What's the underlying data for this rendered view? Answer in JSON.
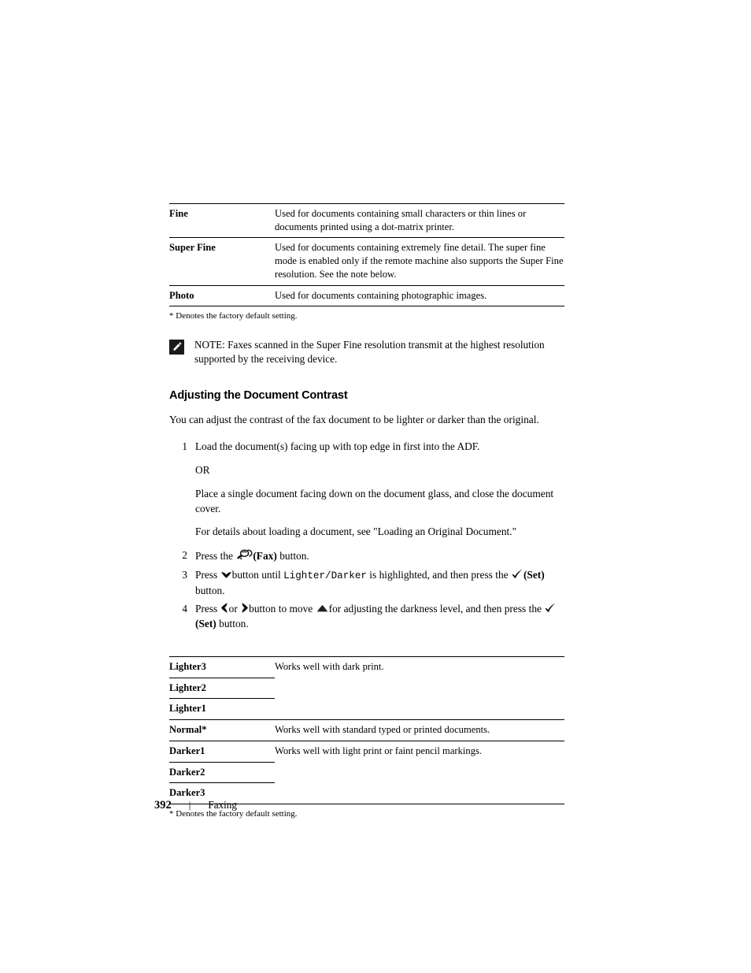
{
  "document": {
    "resolution_table": {
      "rows": [
        {
          "term": "Fine",
          "description": "Used for documents containing small characters or thin lines or documents printed using a dot-matrix printer."
        },
        {
          "term": "Super Fine",
          "description": "Used for documents containing extremely fine detail. The super fine mode is enabled only if the remote machine also supports the Super Fine resolution. See the note below."
        },
        {
          "term": "Photo",
          "description": "Used for documents containing photographic images."
        }
      ],
      "footnote": "* Denotes the factory default setting."
    },
    "note": {
      "icon": "note-pencil-icon",
      "label": "NOTE:",
      "text": "Faxes scanned in the Super Fine resolution transmit at the highest resolution supported by the receiving device."
    },
    "heading": "Adjusting the Document Contrast",
    "intro": "You can adjust the contrast of the fax document to be lighter or darker than the original.",
    "steps": [
      {
        "number": "1",
        "paragraphs": [
          "Load the document(s) facing up with top edge in first into the ADF.",
          "OR",
          "Place a single document facing down on the document glass, and close the document cover.",
          "For details about loading a document, see \"Loading an Original Document.\""
        ]
      },
      {
        "number": "2",
        "prefix": "Press the",
        "icon": "fax-icon",
        "bold_label": "(Fax)",
        "suffix": "button."
      },
      {
        "number": "3",
        "part1": "Press",
        "icon1": "chevron-down-icon",
        "part2": "button until",
        "mono": "Lighter/Darker",
        "part3": "is highlighted, and then press the",
        "icon2": "check-set-icon",
        "bold_label": "(Set)",
        "part4": "button."
      },
      {
        "number": "4",
        "part1": "Press",
        "icon1": "chevron-left-icon",
        "part2": "or",
        "icon2": "chevron-right-icon",
        "part3": "button to move",
        "icon3": "triangle-up-icon",
        "part4": "for adjusting the darkness level, and then press the",
        "icon4": "check-set-icon",
        "bold_label": "(Set)",
        "part5": "button."
      }
    ],
    "contrast_table": {
      "rows": [
        {
          "term": "Lighter3",
          "description": "Works well with dark print.",
          "separator": "short"
        },
        {
          "term": "Lighter2",
          "description": "",
          "separator": "short"
        },
        {
          "term": "Lighter1",
          "description": "",
          "separator": "full"
        },
        {
          "term": "Normal*",
          "description": "Works well with standard typed or printed documents.",
          "separator": "full"
        },
        {
          "term": "Darker1",
          "description": "Works well with light print or faint pencil markings.",
          "separator": "short"
        },
        {
          "term": "Darker2",
          "description": "",
          "separator": "short"
        },
        {
          "term": "Darker3",
          "description": "",
          "separator": "full"
        }
      ],
      "footnote": "* Denotes the factory default setting."
    }
  },
  "footer": {
    "page_number": "392",
    "divider": "|",
    "section": "Faxing"
  }
}
